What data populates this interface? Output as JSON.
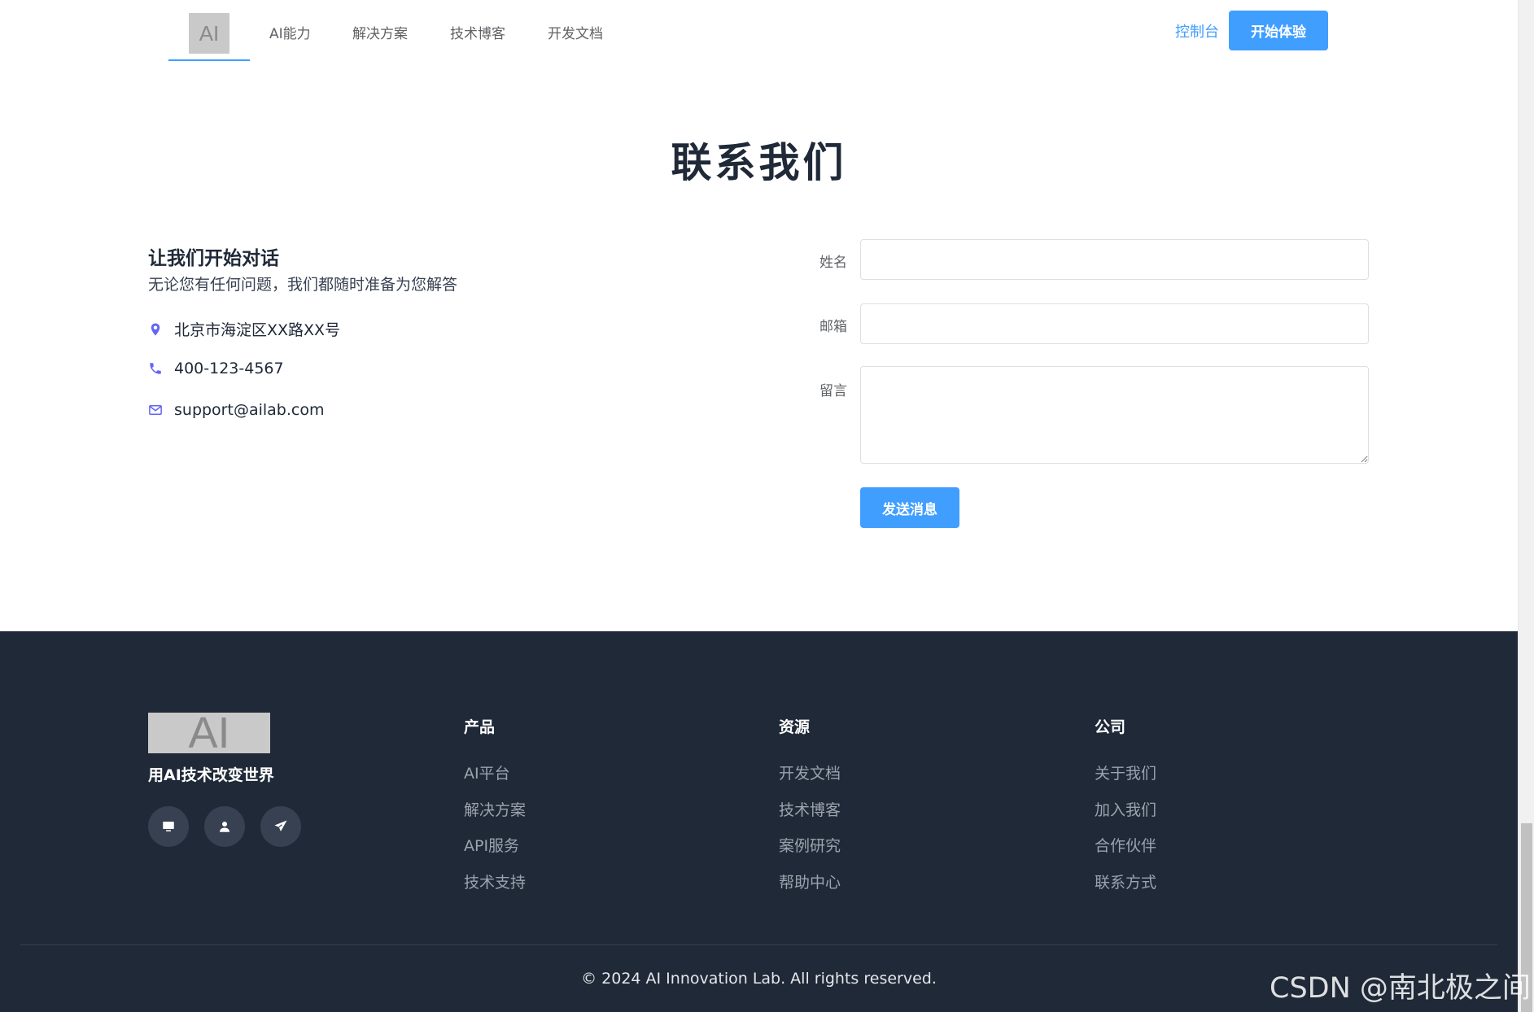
{
  "header": {
    "logo_text": "AI",
    "nav": [
      "AI能力",
      "解决方案",
      "技术博客",
      "开发文档"
    ],
    "console_label": "控制台",
    "start_label": "开始体验",
    "accent_color": "#409eff"
  },
  "contact": {
    "title": "联系我们",
    "heading": "让我们开始对话",
    "subheading": "无论您有任何问题，我们都随时准备为您解答",
    "address": "北京市海淀区XX路XX号",
    "phone": "400-123-4567",
    "email": "support@ailab.com",
    "icon_color": "#6366f1",
    "form": {
      "name_label": "姓名",
      "name_value": "",
      "email_label": "邮箱",
      "email_value": "",
      "message_label": "留言",
      "message_value": "",
      "submit_label": "发送消息"
    }
  },
  "footer": {
    "logo_text": "AI",
    "slogan": "用AI技术改变世界",
    "social_icons": [
      "monitor-icon",
      "user-icon",
      "paper-plane-icon"
    ],
    "columns": [
      {
        "title": "产品",
        "links": [
          "AI平台",
          "解决方案",
          "API服务",
          "技术支持"
        ]
      },
      {
        "title": "资源",
        "links": [
          "开发文档",
          "技术博客",
          "案例研究",
          "帮助中心"
        ]
      },
      {
        "title": "公司",
        "links": [
          "关于我们",
          "加入我们",
          "合作伙伴",
          "联系方式"
        ]
      }
    ],
    "copyright": "© 2024 AI Innovation Lab. All rights reserved.",
    "background_color": "#1f2937"
  },
  "watermark": "CSDN @南北极之间"
}
